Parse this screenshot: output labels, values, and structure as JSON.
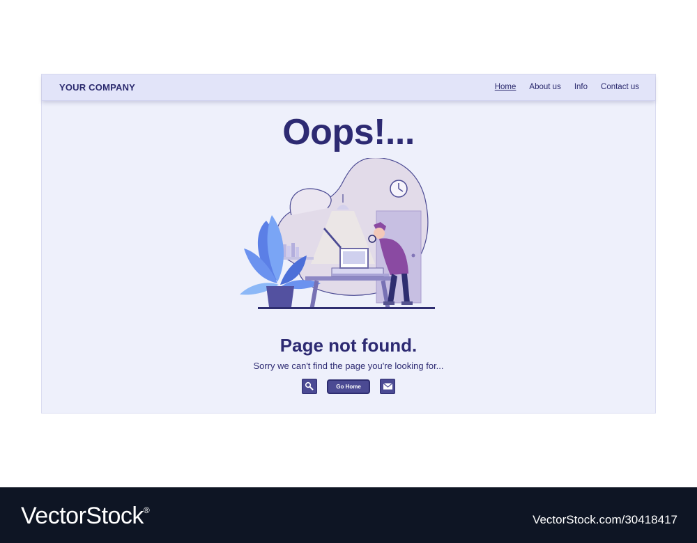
{
  "header": {
    "brand": "YOUR COMPANY",
    "nav": [
      "Home",
      "About us",
      "Info",
      "Contact us"
    ],
    "active_nav": "Home"
  },
  "main": {
    "headline": "Oops!...",
    "subtitle": "Page not found.",
    "description": "Sorry we can't find the page you're looking for...",
    "buttons": {
      "search_icon": "search-icon",
      "home_label": "Go Home",
      "mail_icon": "mail-icon"
    }
  },
  "footer": {
    "logo": "VectorStock",
    "logo_mark": "®",
    "credit": "VectorStock.com/30418417"
  },
  "colors": {
    "primary": "#2d2a72",
    "button": "#4b4a93",
    "background": "#eef0fb",
    "header": "#e2e4f9",
    "footer": "#0e1524"
  }
}
